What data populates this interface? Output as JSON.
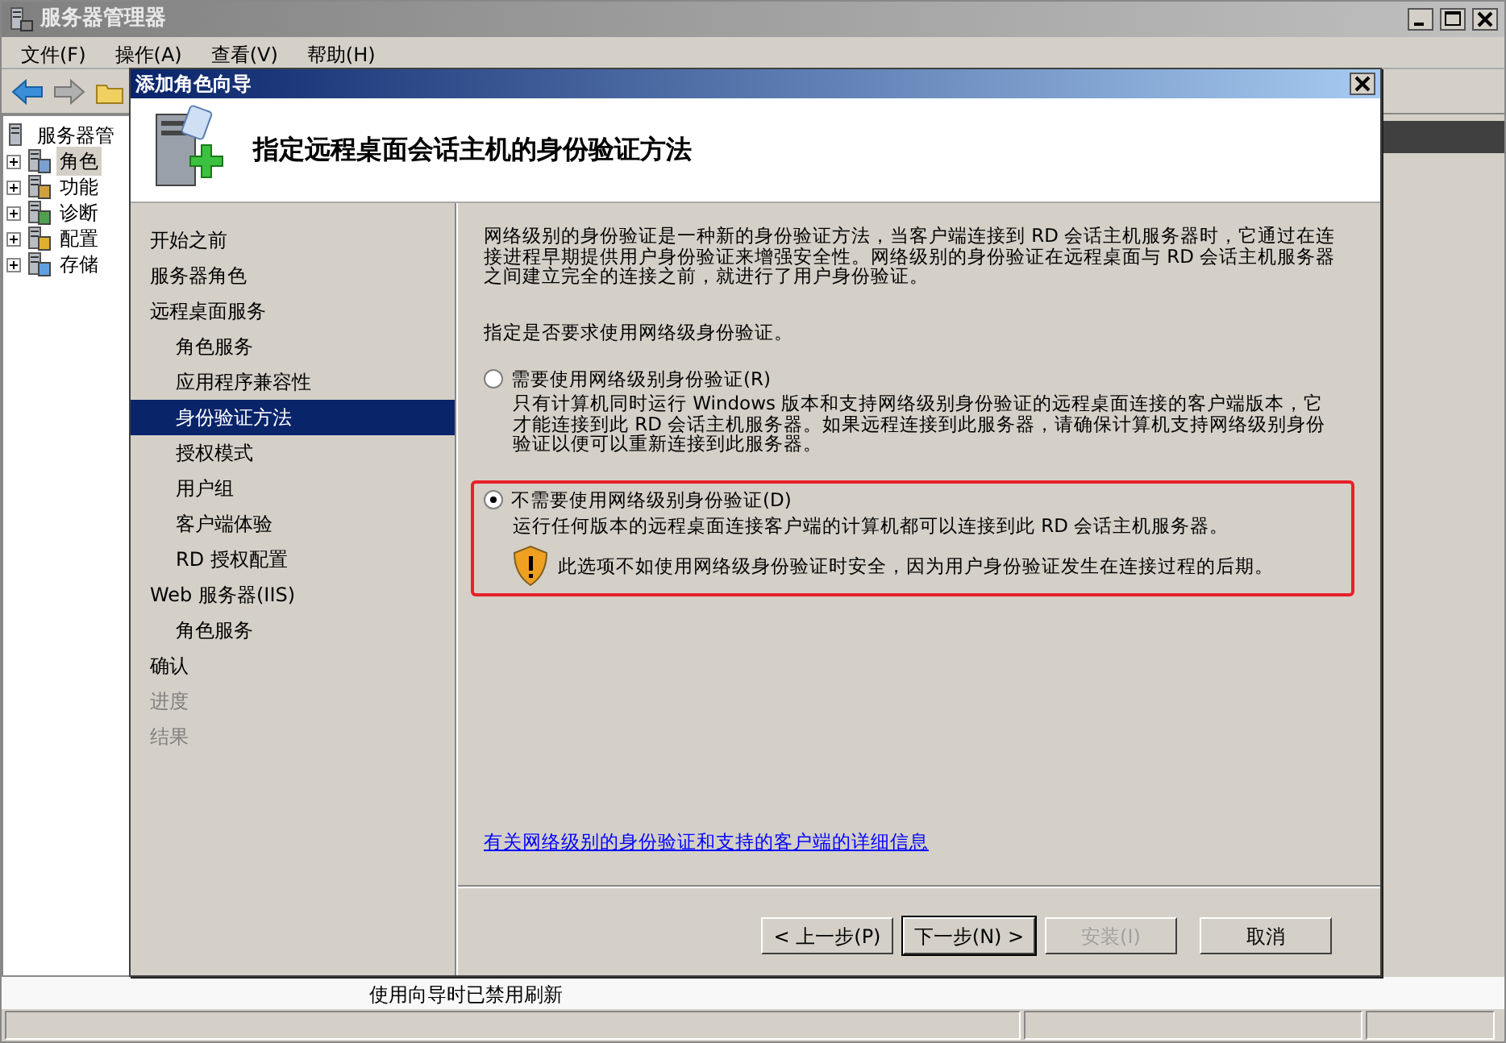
{
  "main_window": {
    "title": "服务器管理器",
    "menu": [
      "文件(F)",
      "操作(A)",
      "查看(V)",
      "帮助(H)"
    ],
    "tree": [
      {
        "label": "服务器管",
        "expanded": true,
        "children": [
          {
            "label": "角色",
            "selected": true,
            "expanded": false
          },
          {
            "label": "功能",
            "selected": false,
            "expanded": false
          },
          {
            "label": "诊断",
            "selected": false,
            "expanded": false
          },
          {
            "label": "配置",
            "selected": false,
            "expanded": false
          },
          {
            "label": "存储",
            "selected": false,
            "expanded": false
          }
        ]
      }
    ],
    "status_text": "使用向导时已禁用刷新"
  },
  "dialog": {
    "title": "添加角色向导",
    "heading": "指定远程桌面会话主机的身份验证方法",
    "steps": [
      {
        "label": "开始之前",
        "selected": false,
        "disabled": false
      },
      {
        "label": "服务器角色",
        "selected": false,
        "disabled": false
      },
      {
        "label": "远程桌面服务",
        "selected": false,
        "disabled": false,
        "children": [
          {
            "label": "角色服务",
            "selected": false,
            "disabled": false
          },
          {
            "label": "应用程序兼容性",
            "selected": false,
            "disabled": false
          },
          {
            "label": "身份验证方法",
            "selected": true,
            "disabled": false
          },
          {
            "label": "授权模式",
            "selected": false,
            "disabled": false
          },
          {
            "label": "用户组",
            "selected": false,
            "disabled": false
          },
          {
            "label": "客户端体验",
            "selected": false,
            "disabled": false
          },
          {
            "label": "RD 授权配置",
            "selected": false,
            "disabled": false
          }
        ]
      },
      {
        "label": "Web 服务器(IIS)",
        "selected": false,
        "disabled": false,
        "children": [
          {
            "label": "角色服务",
            "selected": false,
            "disabled": false
          }
        ]
      },
      {
        "label": "确认",
        "selected": false,
        "disabled": false
      },
      {
        "label": "进度",
        "selected": false,
        "disabled": true
      },
      {
        "label": "结果",
        "selected": false,
        "disabled": true
      }
    ],
    "intro": "网络级别的身份验证是一种新的身份验证方法，当客户端连接到 RD 会话主机服务器时，它通过在连接进程早期提供用户身份验证来增强安全性。网络级别的身份验证在远程桌面与 RD 会话主机服务器之间建立完全的连接之前，就进行了用户身份验证。",
    "prompt": "指定是否要求使用网络级身份验证。",
    "options": [
      {
        "label": "需要使用网络级别身份验证(R)",
        "selected": false,
        "highlighted": false,
        "description": "只有计算机同时运行 Windows 版本和支持网络级别身份验证的远程桌面连接的客户端版本，它才能连接到此 RD 会话主机服务器。如果远程连接到此服务器，请确保计算机支持网络级别身份验证以便可以重新连接到此服务器。"
      },
      {
        "label": "不需要使用网络级别身份验证(D)",
        "selected": true,
        "highlighted": true,
        "description": "运行任何版本的远程桌面连接客户端的计算机都可以连接到此 RD 会话主机服务器。",
        "warning": "此选项不如使用网络级身份验证时安全，因为用户身份验证发生在连接过程的后期。"
      }
    ],
    "link": "有关网络级别的身份验证和支持的客户端的详细信息",
    "buttons": [
      {
        "label": "< 上一步(P)",
        "disabled": false,
        "default": false
      },
      {
        "label": "下一步(N) >",
        "disabled": false,
        "default": true
      },
      {
        "label": "安装(I)",
        "disabled": true,
        "default": false
      },
      {
        "label": "取消",
        "disabled": false,
        "default": false
      }
    ]
  }
}
